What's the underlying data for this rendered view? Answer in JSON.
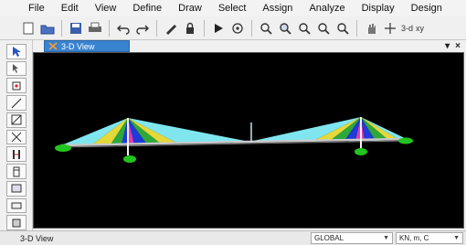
{
  "menu": [
    "File",
    "Edit",
    "View",
    "Define",
    "Draw",
    "Select",
    "Assign",
    "Analyze",
    "Display",
    "Design"
  ],
  "toolbar": {
    "zoom_text": "3-d",
    "xy_text": "xy"
  },
  "document_tab": {
    "label": "3-D View"
  },
  "window_controls": {
    "pin": "▾",
    "close": "×"
  },
  "status": {
    "left": "3-D View",
    "coordinate_system": "GLOBAL",
    "units": "KN, m, C"
  },
  "colors": {
    "viewport_bg": "#000000",
    "deck": "#c9c9c9",
    "pylon": "#f2f2f2",
    "support": "#22c41f",
    "cable_cyan": "#7fe6f0",
    "cable_magenta": "#e03ab8",
    "cable_blue": "#1f3ad8",
    "cable_green": "#2ea83a",
    "cable_yellow": "#e4d83a"
  }
}
